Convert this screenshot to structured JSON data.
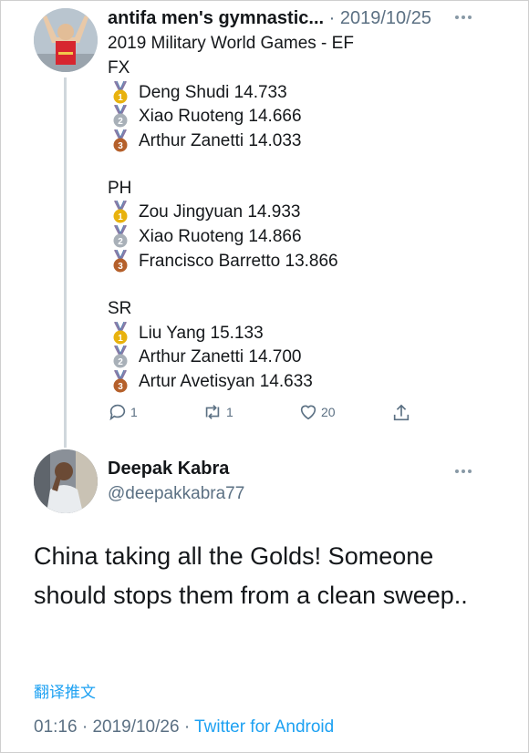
{
  "tweet1": {
    "author": "antifa men's gymnastic...",
    "separator": "·",
    "date": "2019/10/25",
    "title": "2019 Military World Games - EF",
    "events": [
      {
        "code": "FX",
        "results": [
          {
            "medal": "gold",
            "text": "Deng Shudi 14.733"
          },
          {
            "medal": "silver",
            "text": "Xiao Ruoteng 14.666"
          },
          {
            "medal": "bronze",
            "text": "Arthur Zanetti 14.033"
          }
        ]
      },
      {
        "code": "PH",
        "results": [
          {
            "medal": "gold",
            "text": "Zou Jingyuan 14.933"
          },
          {
            "medal": "silver",
            "text": "Xiao Ruoteng 14.866"
          },
          {
            "medal": "bronze",
            "text": "Francisco Barretto 13.866"
          }
        ]
      },
      {
        "code": "SR",
        "results": [
          {
            "medal": "gold",
            "text": "Liu Yang 15.133"
          },
          {
            "medal": "silver",
            "text": "Arthur Zanetti 14.700"
          },
          {
            "medal": "bronze",
            "text": "Artur Avetisyan 14.633"
          }
        ]
      }
    ],
    "counts": {
      "replies": "1",
      "retweets": "1",
      "likes": "20"
    }
  },
  "tweet2": {
    "name": "Deepak Kabra",
    "handle": "@deepakkabra77",
    "body": "China taking all the Golds! Someone should stops them from a clean sweep..",
    "translate": "翻译推文",
    "time": "01:16",
    "separator": "·",
    "date": "2019/10/26",
    "separator2": "·",
    "source": "Twitter for Android"
  },
  "colors": {
    "text": "#14171a",
    "muted": "#5b7083",
    "link": "#1da1f2",
    "gold": "#e8b20e",
    "silver": "#a8b0b8",
    "bronze": "#b5602b"
  }
}
